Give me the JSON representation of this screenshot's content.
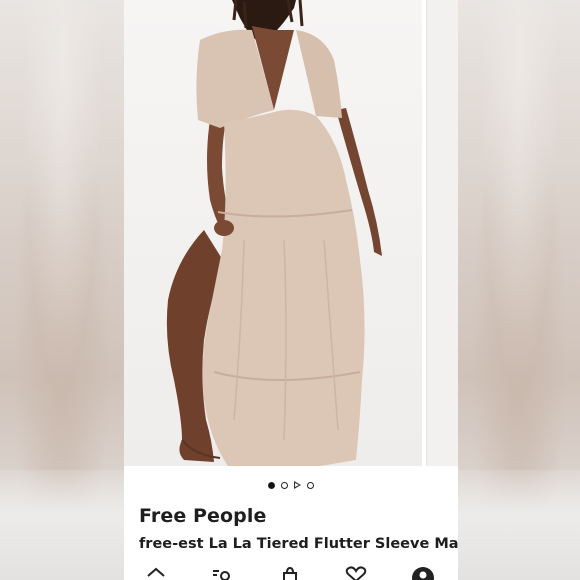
{
  "listing": {
    "brand": "Free People",
    "title": "free-est La La Tiered Flutter Sleeve Maxi"
  },
  "carousel": {
    "dots": [
      "active",
      "inactive",
      "video",
      "inactive"
    ]
  },
  "tabs": [
    {
      "name": "home-tab",
      "icon": "home-icon"
    },
    {
      "name": "feed-tab",
      "icon": "feed-search-icon"
    },
    {
      "name": "sell-tab",
      "icon": "shopping-bag-icon"
    },
    {
      "name": "likes-tab",
      "icon": "heart-icon"
    },
    {
      "name": "profile-tab",
      "icon": "profile-icon"
    }
  ],
  "colors": {
    "dress": "#dcc6b5",
    "skin": "#7a4a34",
    "text": "#1e1e1e"
  }
}
